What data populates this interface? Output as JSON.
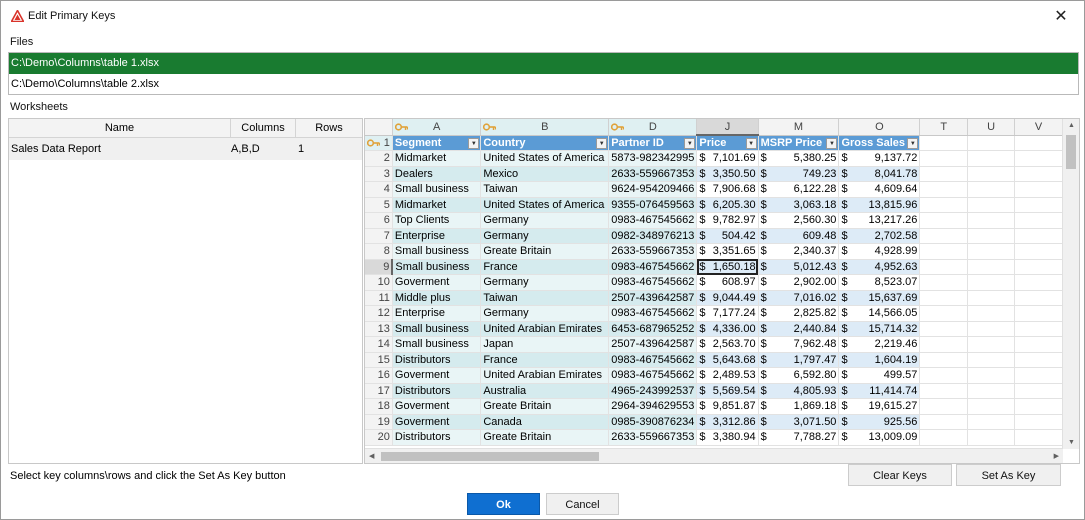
{
  "window": {
    "title": "Edit Primary Keys",
    "close_glyph": "✕"
  },
  "files": {
    "label": "Files",
    "items": [
      {
        "path": "C:\\Demo\\Columns\\table 1.xlsx",
        "selected": true
      },
      {
        "path": "C:\\Demo\\Columns\\table 2.xlsx",
        "selected": false
      }
    ]
  },
  "worksheets": {
    "label": "Worksheets",
    "headers": {
      "name": "Name",
      "columns": "Columns",
      "rows": "Rows"
    },
    "rows": [
      {
        "name": "Sales Data Report",
        "columns": "A,B,D",
        "rows": "1"
      }
    ]
  },
  "grid": {
    "column_letters": [
      "A",
      "B",
      "D",
      "J",
      "M",
      "O",
      "T",
      "U",
      "V"
    ],
    "key_columns": [
      "A",
      "B",
      "D"
    ],
    "active_column": "J",
    "key_rows": [
      "1"
    ],
    "active_row": "9",
    "selected_cell": "J9",
    "headers": [
      "Segment",
      "Country",
      "Partner ID",
      "Price",
      "MSRP Price",
      "Gross Sales"
    ],
    "currency_symbol": "$",
    "rows": [
      {
        "num": "2",
        "segment": "Midmarket",
        "country": "United States of America",
        "partner": "5873-982342995",
        "price": "7,101.69",
        "msrp": "5,380.25",
        "gross": "9,137.72"
      },
      {
        "num": "3",
        "segment": "Dealers",
        "country": "Mexico",
        "partner": "2633-559667353",
        "price": "3,350.50",
        "msrp": "749.23",
        "gross": "8,041.78"
      },
      {
        "num": "4",
        "segment": "Small business",
        "country": "Taiwan",
        "partner": "9624-954209466",
        "price": "7,906.68",
        "msrp": "6,122.28",
        "gross": "4,609.64"
      },
      {
        "num": "5",
        "segment": "Midmarket",
        "country": "United States of America",
        "partner": "9355-076459563",
        "price": "6,205.30",
        "msrp": "3,063.18",
        "gross": "13,815.96"
      },
      {
        "num": "6",
        "segment": "Top Clients",
        "country": "Germany",
        "partner": "0983-467545662",
        "price": "9,782.97",
        "msrp": "2,560.30",
        "gross": "13,217.26"
      },
      {
        "num": "7",
        "segment": "Enterprise",
        "country": "Germany",
        "partner": "0982-348976213",
        "price": "504.42",
        "msrp": "609.48",
        "gross": "2,702.58"
      },
      {
        "num": "8",
        "segment": "Small business",
        "country": "Greate Britain",
        "partner": "2633-559667353",
        "price": "3,351.65",
        "msrp": "2,340.37",
        "gross": "4,928.99"
      },
      {
        "num": "9",
        "segment": "Small business",
        "country": "France",
        "partner": "0983-467545662",
        "price": "1,650.18",
        "msrp": "5,012.43",
        "gross": "4,952.63"
      },
      {
        "num": "10",
        "segment": "Goverment",
        "country": "Germany",
        "partner": "0983-467545662",
        "price": "608.97",
        "msrp": "2,902.00",
        "gross": "8,523.07"
      },
      {
        "num": "11",
        "segment": "Middle plus",
        "country": "Taiwan",
        "partner": "2507-439642587",
        "price": "9,044.49",
        "msrp": "7,016.02",
        "gross": "15,637.69"
      },
      {
        "num": "12",
        "segment": "Enterprise",
        "country": "Germany",
        "partner": "0983-467545662",
        "price": "7,177.24",
        "msrp": "2,825.82",
        "gross": "14,566.05"
      },
      {
        "num": "13",
        "segment": "Small business",
        "country": "United Arabian Emirates",
        "partner": "6453-687965252",
        "price": "4,336.00",
        "msrp": "2,440.84",
        "gross": "15,714.32"
      },
      {
        "num": "14",
        "segment": "Small business",
        "country": "Japan",
        "partner": "2507-439642587",
        "price": "2,563.70",
        "msrp": "7,962.48",
        "gross": "2,219.46"
      },
      {
        "num": "15",
        "segment": "Distributors",
        "country": "France",
        "partner": "0983-467545662",
        "price": "5,643.68",
        "msrp": "1,797.47",
        "gross": "1,604.19"
      },
      {
        "num": "16",
        "segment": "Goverment",
        "country": "United Arabian Emirates",
        "partner": "0983-467545662",
        "price": "2,489.53",
        "msrp": "6,592.80",
        "gross": "499.57"
      },
      {
        "num": "17",
        "segment": "Distributors",
        "country": "Australia",
        "partner": "4965-243992537",
        "price": "5,569.54",
        "msrp": "4,805.93",
        "gross": "11,414.74"
      },
      {
        "num": "18",
        "segment": "Goverment",
        "country": "Greate Britain",
        "partner": "2964-394629553",
        "price": "9,851.87",
        "msrp": "1,869.18",
        "gross": "19,615.27"
      },
      {
        "num": "19",
        "segment": "Goverment",
        "country": "Canada",
        "partner": "0985-390876234",
        "price": "3,312.86",
        "msrp": "3,071.50",
        "gross": "925.56"
      },
      {
        "num": "20",
        "segment": "Distributors",
        "country": "Greate Britain",
        "partner": "2633-559667353",
        "price": "3,380.94",
        "msrp": "7,788.27",
        "gross": "13,009.09"
      }
    ]
  },
  "footer": {
    "hint": "Select key columns\\rows and click the Set As Key button",
    "clear_keys": "Clear Keys",
    "set_as_key": "Set As Key",
    "ok": "Ok",
    "cancel": "Cancel"
  },
  "colors": {
    "selected_file": "#197b30",
    "table_header": "#5b9bd5",
    "band": "#ddebf7",
    "primary_button": "#0f6fd1",
    "key_icon": "#e0a23a"
  }
}
